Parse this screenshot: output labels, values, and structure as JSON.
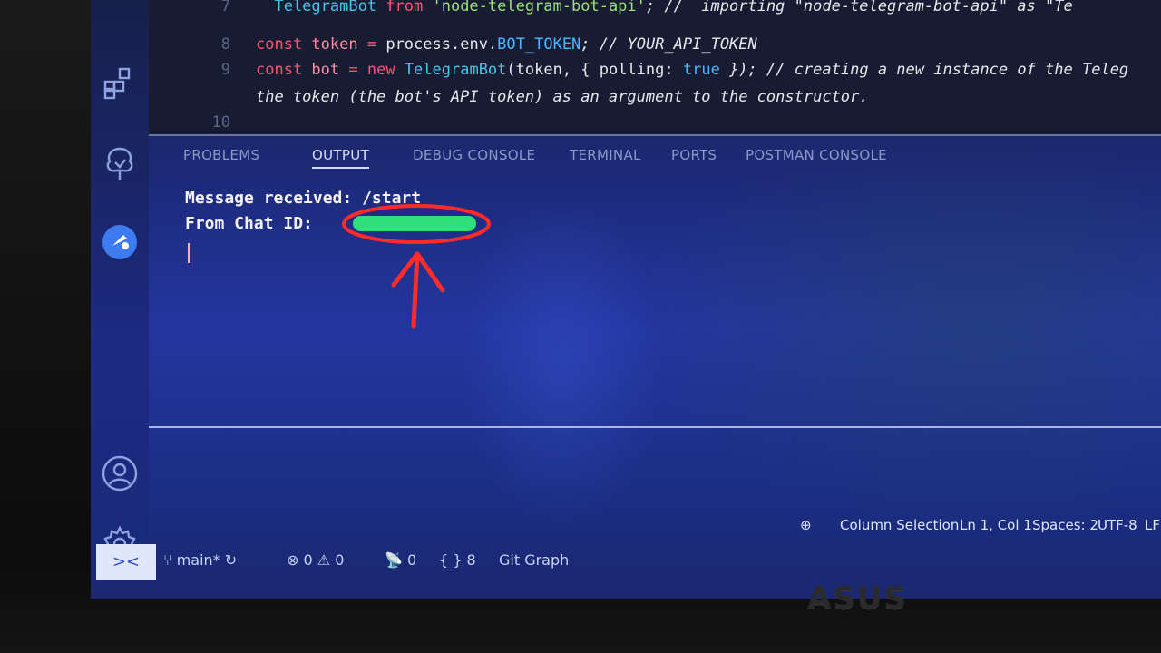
{
  "editor": {
    "lines": [
      {
        "number": "7",
        "tokens": [
          {
            "t": "  TelegramBot ",
            "c": "cls"
          },
          {
            "t": "from ",
            "c": "kw"
          },
          {
            "t": "'node-telegram-bot-api'",
            "c": "str"
          },
          {
            "t": "; //  importing \"node-telegram-bot-api\" as \"Te",
            "c": "cm"
          }
        ]
      },
      {
        "number": "8",
        "tokens": [
          {
            "t": "const ",
            "c": "kw"
          },
          {
            "t": "token ",
            "c": "var"
          },
          {
            "t": "= ",
            "c": "kw"
          },
          {
            "t": "process",
            "c": "prop"
          },
          {
            "t": ".env.",
            "c": "prop"
          },
          {
            "t": "BOT_TOKEN",
            "c": "lit"
          },
          {
            "t": "; // YOUR_API_TOKEN",
            "c": "cm"
          }
        ]
      },
      {
        "number": "9",
        "tokens": [
          {
            "t": "const ",
            "c": "kw"
          },
          {
            "t": "bot ",
            "c": "var"
          },
          {
            "t": "= ",
            "c": "kw"
          },
          {
            "t": "new ",
            "c": "kw"
          },
          {
            "t": "TelegramBot",
            "c": "cls"
          },
          {
            "t": "(token, { polling: ",
            "c": "prop"
          },
          {
            "t": "true",
            "c": "lit"
          },
          {
            "t": " }); // creating a new instance of the Teleg",
            "c": "cm"
          }
        ]
      },
      {
        "number": "",
        "tokens": [
          {
            "t": "the token (the bot's API token) as an argument to the constructor.",
            "c": "cm"
          }
        ]
      },
      {
        "number": "10",
        "tokens": []
      }
    ]
  },
  "panel": {
    "tabs": [
      {
        "label": "PROBLEMS"
      },
      {
        "label": "OUTPUT"
      },
      {
        "label": "DEBUG CONSOLE"
      },
      {
        "label": "TERMINAL"
      },
      {
        "label": "PORTS"
      },
      {
        "label": "POSTMAN CONSOLE"
      }
    ],
    "active_tab": "OUTPUT",
    "output": {
      "line1": "Message received: /start",
      "line2_label": "From Chat ID:"
    }
  },
  "status": {
    "remote_icon": "><",
    "branch": "main*",
    "errors": "0",
    "warnings": "0",
    "ports": "0",
    "braces": "{ }",
    "brace_count": "8",
    "git_graph": "Git Graph",
    "column_selection": "Column Selection",
    "position": "Ln 1, Col 1",
    "spaces": "Spaces: 2",
    "encoding": "UTF-8",
    "eol": "LF"
  },
  "monitor": {
    "brand": "ASUS"
  },
  "colors": {
    "accent": "#2ee07a",
    "annotation": "#ff2b2b",
    "panel_bg": "#2236a0"
  }
}
